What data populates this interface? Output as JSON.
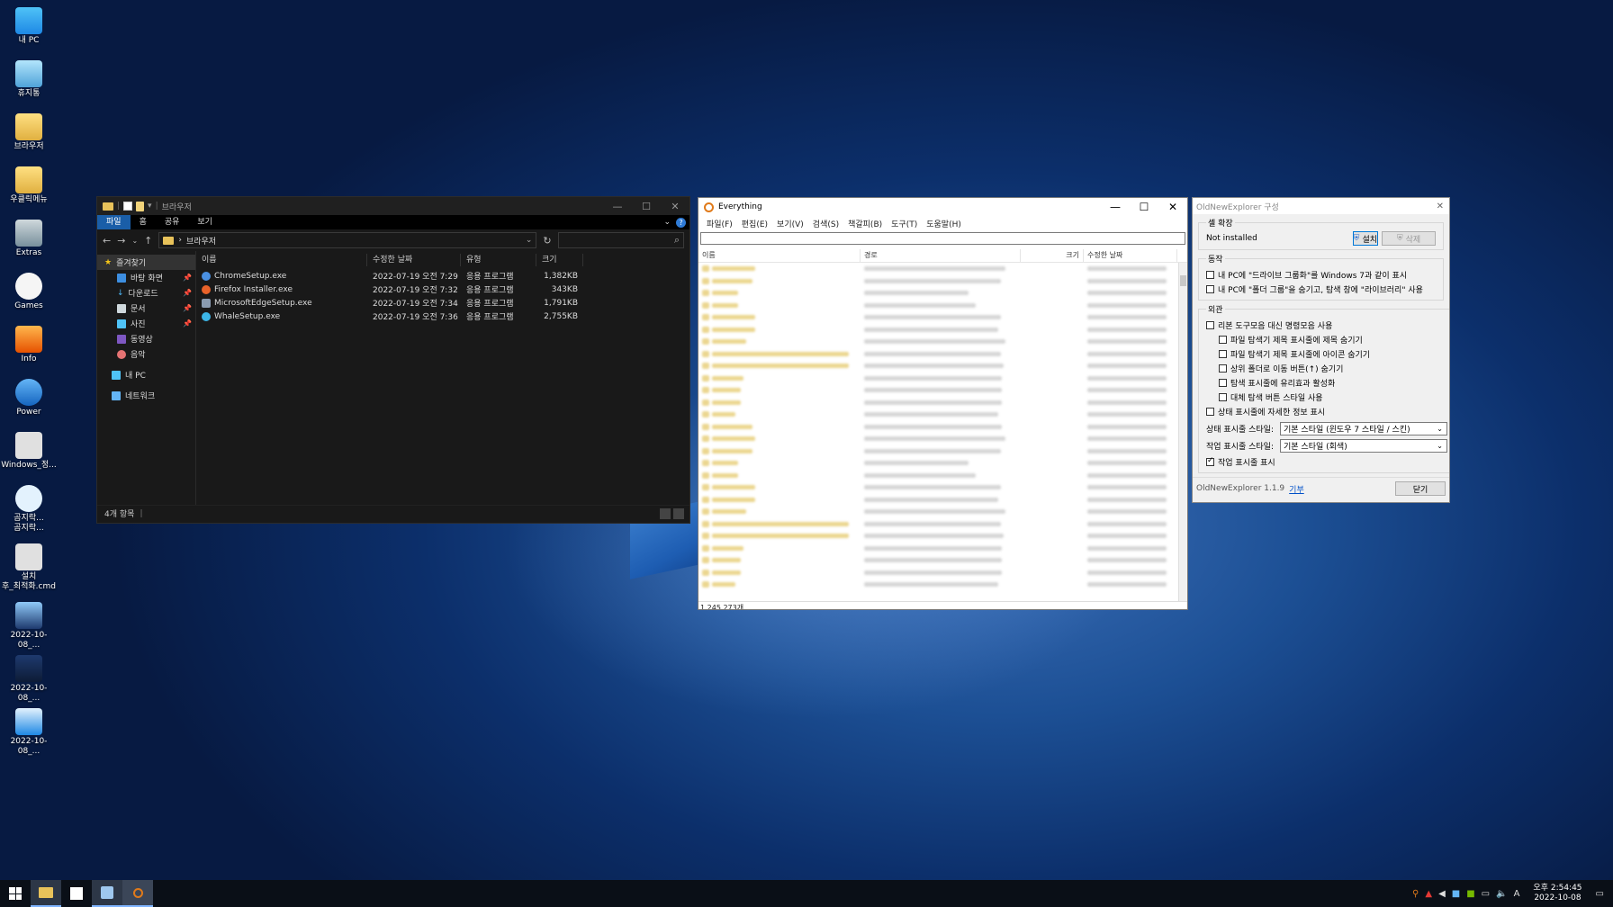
{
  "desktop": {
    "icons": [
      {
        "label": "내 PC",
        "icon": "pc-icon"
      },
      {
        "label": "휴지통",
        "icon": "recycle-bin-icon"
      },
      {
        "label": "브라우저",
        "icon": "folder-icon"
      },
      {
        "label": "우클릭메뉴",
        "icon": "folder-icon"
      },
      {
        "label": "Extras",
        "icon": "folder-icon"
      },
      {
        "label": "Games",
        "icon": "gamepad-icon"
      },
      {
        "label": "Info",
        "icon": "phoenix-icon"
      },
      {
        "label": "Power",
        "icon": "power-icon"
      },
      {
        "label": "Windows_정...",
        "icon": "settings-file-icon"
      },
      {
        "label": "곰지락...\n곰지락...",
        "icon": "ie-icon"
      },
      {
        "label": "설치\n후_최적화.cmd",
        "icon": "settings-file-icon"
      },
      {
        "label": "2022-10-08_...",
        "icon": "image-file-icon"
      },
      {
        "label": "2022-10-08_...",
        "icon": "image-file-icon"
      },
      {
        "label": "2022-10-08_...",
        "icon": "image-file-icon"
      }
    ]
  },
  "explorer": {
    "title": "브라우저",
    "ribbon_tabs": [
      "파일",
      "홈",
      "공유",
      "보기"
    ],
    "address": "브라우저",
    "nav": [
      {
        "label": "즐겨찾기",
        "icon": "star-icon",
        "pinned": false
      },
      {
        "label": "바탕 화면",
        "icon": "desktop-icon",
        "pinned": true
      },
      {
        "label": "다운로드",
        "icon": "download-icon",
        "pinned": true
      },
      {
        "label": "문서",
        "icon": "document-icon",
        "pinned": true
      },
      {
        "label": "사진",
        "icon": "pictures-icon",
        "pinned": true
      },
      {
        "label": "동영상",
        "icon": "video-icon",
        "pinned": false
      },
      {
        "label": "음악",
        "icon": "music-icon",
        "pinned": false
      },
      {
        "label": "내 PC",
        "icon": "pc-icon",
        "pinned": false
      },
      {
        "label": "네트워크",
        "icon": "network-icon",
        "pinned": false
      }
    ],
    "columns": [
      "이름",
      "수정한 날짜",
      "유형",
      "크기"
    ],
    "files": [
      {
        "name": "ChromeSetup.exe",
        "date": "2022-07-19 오전 7:29",
        "type": "응용 프로그램",
        "size": "1,382KB",
        "color": "#4a90e2"
      },
      {
        "name": "Firefox Installer.exe",
        "date": "2022-07-19 오전 7:32",
        "type": "응용 프로그램",
        "size": "343KB",
        "color": "#e8622a"
      },
      {
        "name": "MicrosoftEdgeSetup.exe",
        "date": "2022-07-19 오전 7:34",
        "type": "응용 프로그램",
        "size": "1,791KB",
        "color": "#8a9bb0"
      },
      {
        "name": "WhaleSetup.exe",
        "date": "2022-07-19 오전 7:36",
        "type": "응용 프로그램",
        "size": "2,755KB",
        "color": "#3cb6e8"
      }
    ],
    "status": "4개 항목"
  },
  "everything": {
    "title": "Everything",
    "menu": [
      "파일(F)",
      "편집(E)",
      "보기(V)",
      "검색(S)",
      "책갈피(B)",
      "도구(T)",
      "도움말(H)"
    ],
    "columns": [
      "이름",
      "경로",
      "크기",
      "수정한 날짜"
    ],
    "status": "1,245,273개"
  },
  "oldnewexplorer": {
    "title": "OldNewExplorer 구성",
    "shell_ext_legend": "셸 확장",
    "status_value": "Not installed",
    "install_label": "설치",
    "uninstall_label": "삭제",
    "behavior_legend": "동작",
    "behavior_options": [
      {
        "label": "내 PC에 \"드라이브 그룹화\"를 Windows 7과 같이 표시",
        "checked": false
      },
      {
        "label": "내 PC에 \"폴더 그룹\"을 숨기고, 탐색 창에 \"라이브러리\" 사용",
        "checked": false
      }
    ],
    "appearance_legend": "외관",
    "appearance_options": [
      {
        "label": "리본 도구모음 대신 명령모음 사용",
        "checked": false,
        "indent": false
      },
      {
        "label": "파일 탐색기 제목 표시줄에 제목 숨기기",
        "checked": false,
        "indent": true
      },
      {
        "label": "파일 탐색기 제목 표시줄에 아이콘 숨기기",
        "checked": false,
        "indent": true
      },
      {
        "label": "상위 폴더로 이동 버튼(↑) 숨기기",
        "checked": false,
        "indent": true
      },
      {
        "label": "탐색 표시줄에 유리효과 활성화",
        "checked": false,
        "indent": true
      },
      {
        "label": "대체 탐색 버튼 스타일 사용",
        "checked": false,
        "indent": true
      },
      {
        "label": "상태 표시줄에 자세한 정보 표시",
        "checked": false,
        "indent": false
      }
    ],
    "statusbar_style_label": "상태 표시줄 스타일:",
    "statusbar_style_value": "기본 스타일 (윈도우 7 스타일 / 스킨)",
    "taskbar_style_label": "작업 표시줄 스타일:",
    "taskbar_style_value": "기본 스타일 (회색)",
    "show_taskbar_label": "작업 표시줄 표시",
    "show_taskbar_checked": true,
    "version": "OldNewExplorer 1.1.9",
    "link_label": "기부",
    "close_label": "닫기"
  },
  "taskbar": {
    "time": "오후 2:54:45",
    "date": "2022-10-08",
    "ime": "A"
  }
}
